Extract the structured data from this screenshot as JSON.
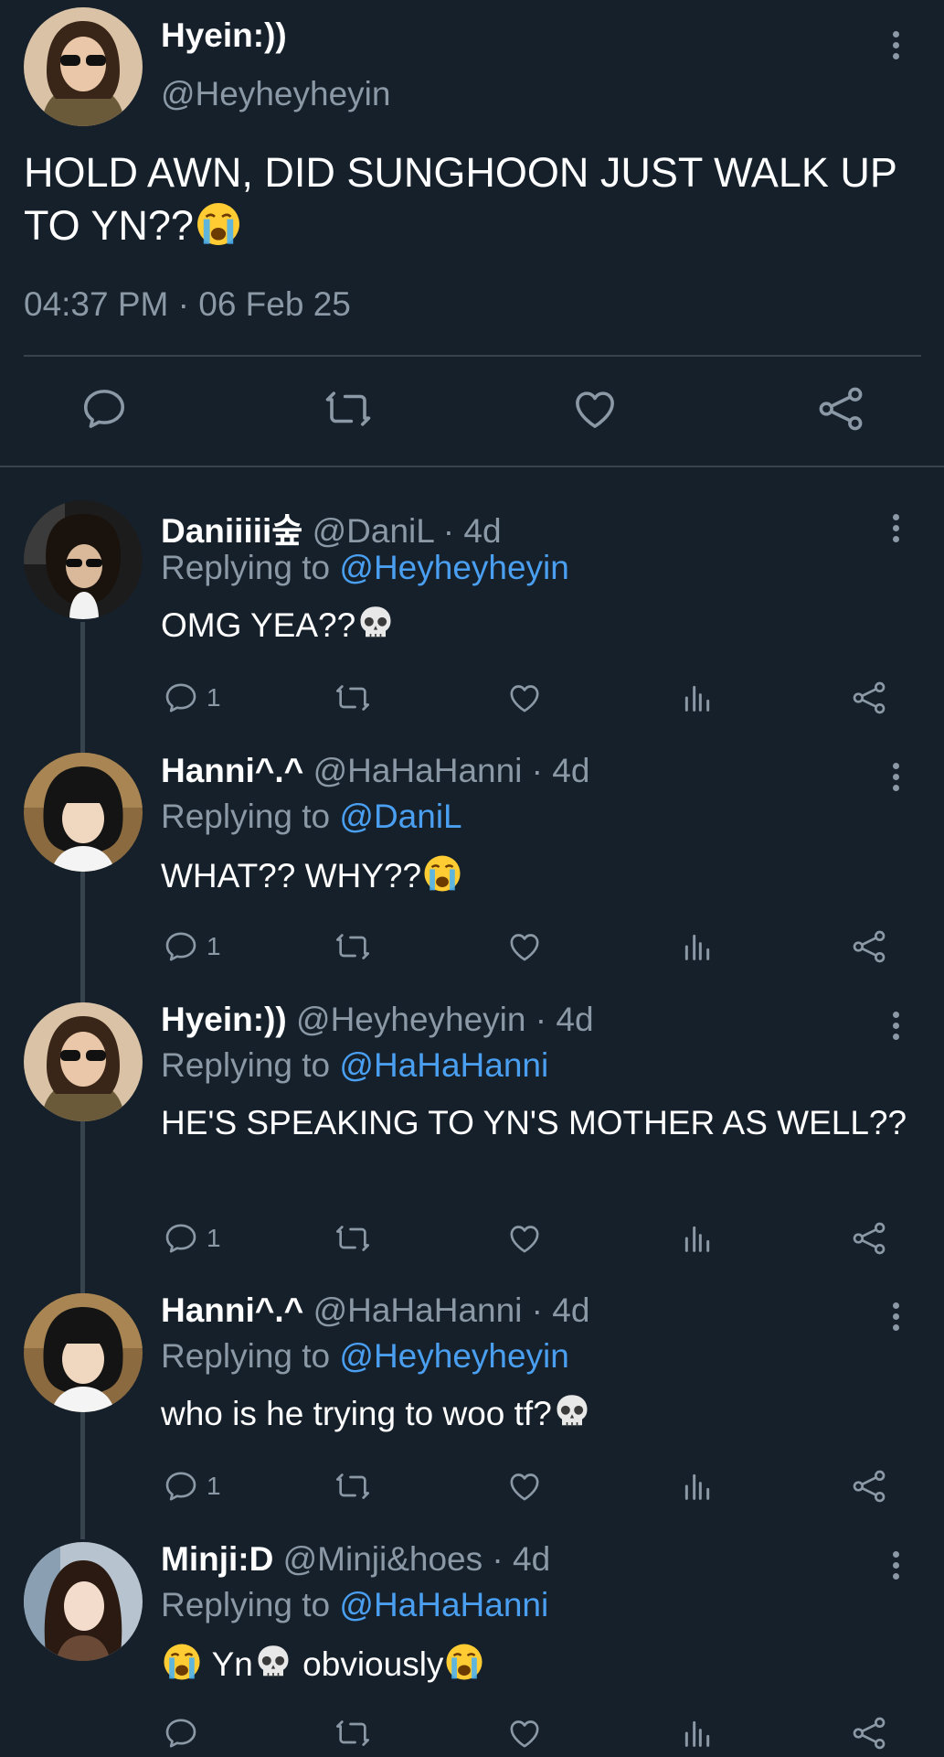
{
  "main_tweet": {
    "name": "Hyein:))",
    "handle": "@Heyheyheyin",
    "text": "HOLD AWN, DID SUNGHOON JUST WALK UP TO YN??",
    "text_emoji": "crying-face-emoji",
    "timestamp": "04:37 PM · 06 Feb 25",
    "actions": [
      "reply-icon",
      "retweet-icon",
      "like-icon",
      "share-icon"
    ]
  },
  "replies": [
    {
      "name": "Daniiiii숲",
      "handle": "@DaniL · 4d",
      "replying_prefix": "Replying to ",
      "replying_to": "@Heyheyheyin",
      "text": "OMG YEA??",
      "reply_count": "1"
    },
    {
      "name": "Hanni^.^",
      "handle": "@HaHaHanni · 4d",
      "replying_prefix": "Replying to ",
      "replying_to": "@DaniL",
      "text": "WHAT?? WHY??",
      "reply_count": "1"
    },
    {
      "name": "Hyein:))",
      "handle": "@Heyheyheyin · 4d",
      "replying_prefix": "Replying to ",
      "replying_to": "@HaHaHanni",
      "text": "HE'S SPEAKING TO YN'S MOTHER AS WELL??",
      "reply_count": "1"
    },
    {
      "name": "Hanni^.^",
      "handle": "@HaHaHanni · 4d",
      "replying_prefix": "Replying to ",
      "replying_to": "@Heyheyheyin",
      "text": "who is he trying to woo tf?",
      "reply_count": "1"
    },
    {
      "name": "Minji:D",
      "handle": "@Minji&hoes · 4d",
      "replying_prefix": "Replying to ",
      "replying_to": "@HaHaHanni",
      "text_parts": [
        "Yn",
        " obviously"
      ],
      "reply_count": ""
    }
  ],
  "colors": {
    "background": "#15202b",
    "muted": "#8b98a5",
    "link": "#4a9ff0",
    "divider": "#38444d"
  }
}
